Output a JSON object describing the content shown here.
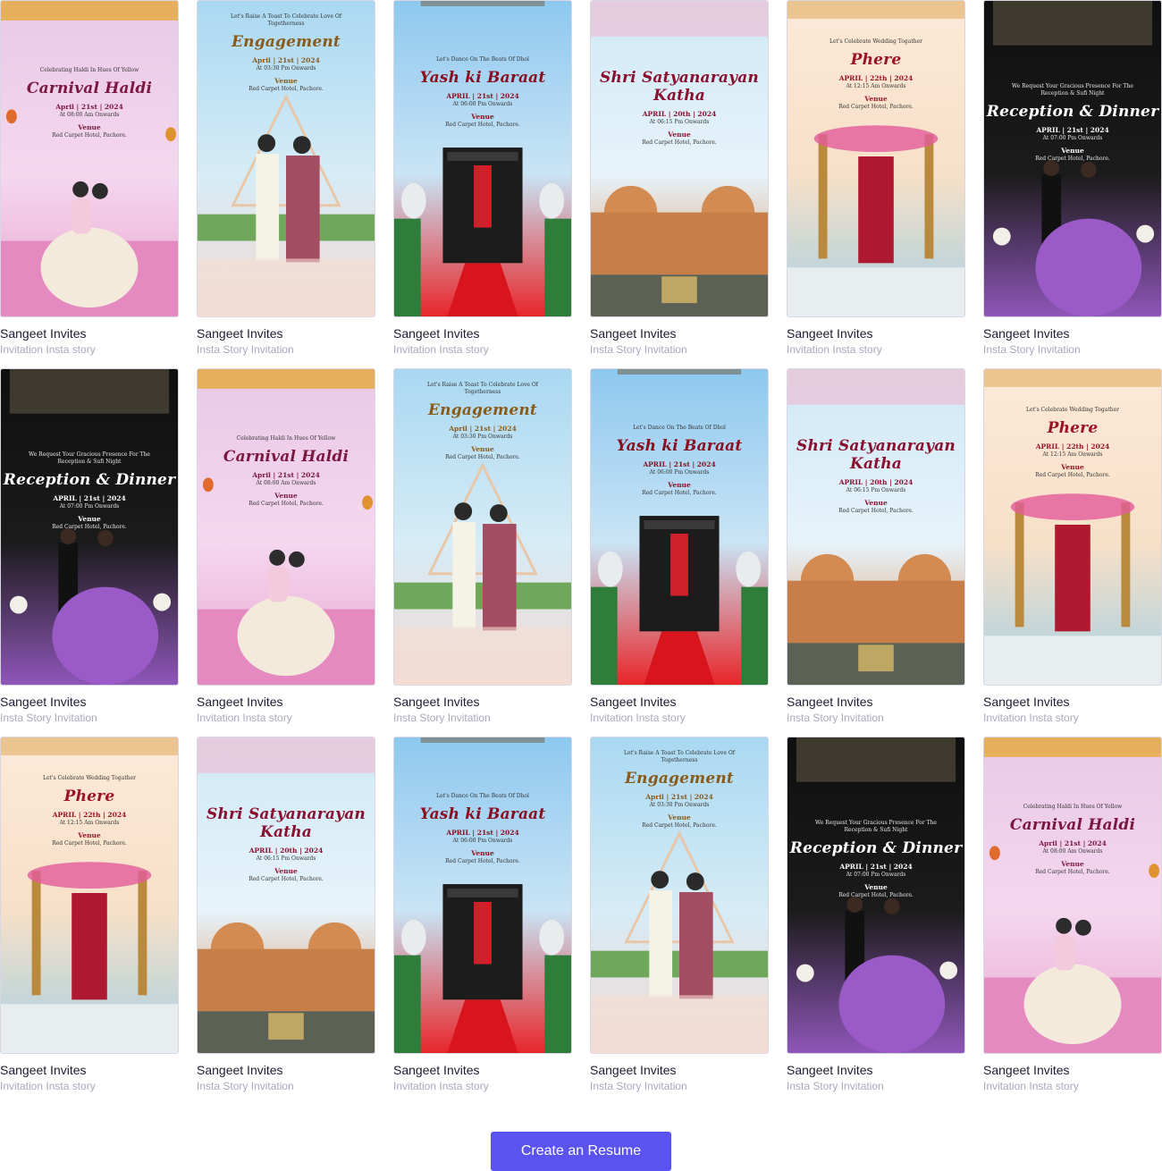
{
  "cta": {
    "label": "Create an Resume"
  },
  "themes": {
    "haldi": {
      "pre": "Celebrating Haldi In Hues Of Yellow",
      "title": "Carnival Haldi",
      "date": "April | 21st | 2024",
      "time": "At 08:00 Am Onwards",
      "venue": "Venue",
      "addr": "Red Carpet Hotel, Pachore.",
      "colors": {
        "top": "#e9c8e6",
        "mid": "#f5d7ee",
        "bot": "#e7a6cf",
        "ink": "#7a1840"
      }
    },
    "engagement": {
      "pre": "Let's Raise A Toast To Celebrate Love Of Togetherness",
      "title": "Engagement",
      "date": "April | 21st | 2024",
      "time": "At 03:30 Pm Onwards",
      "venue": "Venue",
      "addr": "Red Carpet Hotel, Pachore.",
      "colors": {
        "top": "#a9d8f2",
        "mid": "#d6ecf6",
        "bot": "#f3d9d2",
        "ink": "#8a5a18"
      }
    },
    "baraat": {
      "pre": "Let's Dance On The Beats Of Dhol",
      "title": "Yash ki Baraat",
      "date": "APRIL | 21st | 2024",
      "time": "At 06:00 Pm Onwards",
      "venue": "Venue",
      "addr": "Red Carpet Hotel, Pachore.",
      "colors": {
        "top": "#8ec8ef",
        "mid": "#c9e4f5",
        "bot": "#e8262a",
        "ink": "#8a1020"
      }
    },
    "katha": {
      "pre": "",
      "title": "Shri Satyanarayan Katha",
      "date": "APRIL | 20th | 2024",
      "time": "At 06:15 Pm Onwards",
      "venue": "Venue",
      "addr": "Red Carpet Hotel, Pachore.",
      "colors": {
        "top": "#cfe9f6",
        "mid": "#e7f3fa",
        "bot": "#d9894f",
        "ink": "#8a1030"
      }
    },
    "phere": {
      "pre": "Let's Celebrate Wedding Togather",
      "title": "Phere",
      "date": "APRIL | 22th | 2024",
      "time": "At 12:15 Am Onwards",
      "venue": "Venue",
      "addr": "Red Carpet Hotel, Pachore.",
      "colors": {
        "top": "#fde9d8",
        "mid": "#f7e0c8",
        "bot": "#a7d0e2",
        "ink": "#9a1426"
      }
    },
    "reception": {
      "pre": "We Request Your Gracious Presence For The Reception & Sufi Night",
      "title": "Reception & Dinner",
      "date": "APRIL | 21st | 2024",
      "time": "At 07:00 Pm Onwards",
      "venue": "Venue",
      "addr": "Red Carpet Hotel, Pachore.",
      "colors": {
        "top": "#0f0f0f",
        "mid": "#1b1b1b",
        "bot": "#8e56b8",
        "ink": "#ffffff"
      }
    }
  },
  "cards": [
    {
      "theme": "haldi",
      "name": "Sangeet Invites",
      "sub": "Invitation Insta story"
    },
    {
      "theme": "engagement",
      "name": "Sangeet Invites",
      "sub": "Insta Story Invitation"
    },
    {
      "theme": "baraat",
      "name": "Sangeet Invites",
      "sub": "Invitation Insta story"
    },
    {
      "theme": "katha",
      "name": "Sangeet Invites",
      "sub": "Insta Story Invitation"
    },
    {
      "theme": "phere",
      "name": "Sangeet Invites",
      "sub": "Invitation Insta story"
    },
    {
      "theme": "reception",
      "name": "Sangeet Invites",
      "sub": "Insta Story Invitation"
    },
    {
      "theme": "reception",
      "name": "Sangeet Invites",
      "sub": "Insta Story Invitation"
    },
    {
      "theme": "haldi",
      "name": "Sangeet Invites",
      "sub": "Invitation Insta story"
    },
    {
      "theme": "engagement",
      "name": "Sangeet Invites",
      "sub": "Insta Story Invitation"
    },
    {
      "theme": "baraat",
      "name": "Sangeet Invites",
      "sub": "Invitation Insta story"
    },
    {
      "theme": "katha",
      "name": "Sangeet Invites",
      "sub": "Insta Story Invitation"
    },
    {
      "theme": "phere",
      "name": "Sangeet Invites",
      "sub": "Invitation Insta story"
    },
    {
      "theme": "phere",
      "name": "Sangeet Invites",
      "sub": "Invitation Insta story"
    },
    {
      "theme": "katha",
      "name": "Sangeet Invites",
      "sub": "Insta Story Invitation"
    },
    {
      "theme": "baraat",
      "name": "Sangeet Invites",
      "sub": "Invitation Insta story"
    },
    {
      "theme": "engagement",
      "name": "Sangeet Invites",
      "sub": "Insta Story Invitation"
    },
    {
      "theme": "reception",
      "name": "Sangeet Invites",
      "sub": "Insta Story Invitation"
    },
    {
      "theme": "haldi",
      "name": "Sangeet Invites",
      "sub": "Invitation Insta story"
    }
  ]
}
